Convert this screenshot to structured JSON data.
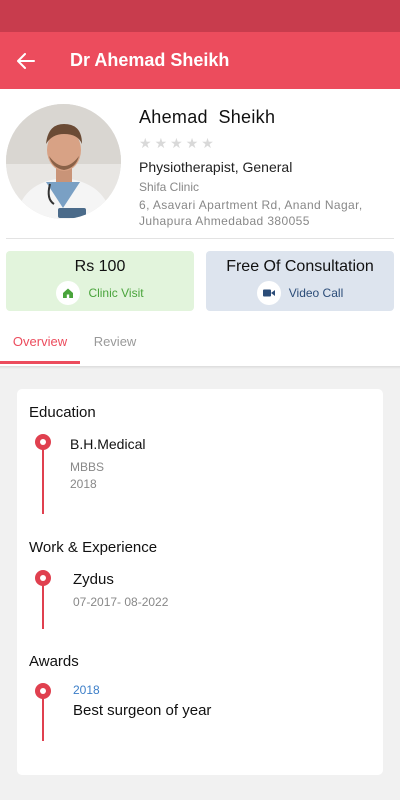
{
  "header": {
    "title": "Dr Ahemad Sheikh",
    "back_icon": "arrow-left-icon"
  },
  "profile": {
    "name": "Ahemad  Sheikh",
    "rating": 0,
    "rating_max": 5,
    "specialty": "Physiotherapist, General",
    "clinic": "Shifa Clinic",
    "address_line1": "6, Asavari Apartment Rd, Anand Nagar,",
    "address_line2": "Juhapura Ahmedabad 380055"
  },
  "consult": {
    "clinic": {
      "price": "Rs 100",
      "label": "Clinic Visit",
      "icon": "home-icon"
    },
    "video": {
      "price": "Free Of Consultation",
      "label": "Video Call",
      "icon": "video-camera-icon"
    }
  },
  "tabs": [
    {
      "label": "Overview",
      "active": true
    },
    {
      "label": "Review",
      "active": false
    }
  ],
  "overview": {
    "education": {
      "title": "Education",
      "institution": "B.H.Medical",
      "degree": "MBBS",
      "year": "2018"
    },
    "work": {
      "title": "Work & Experience",
      "company": "Zydus",
      "period": "07-2017- 08-2022"
    },
    "awards": {
      "title": "Awards",
      "year": "2018",
      "name": "Best surgeon of year"
    }
  },
  "colors": {
    "primary": "#ec4c5d",
    "status_bar": "#c83c4d",
    "clinic_green": "#4aa43c",
    "video_blue": "#2b4c78",
    "timeline": "#e0404f"
  }
}
